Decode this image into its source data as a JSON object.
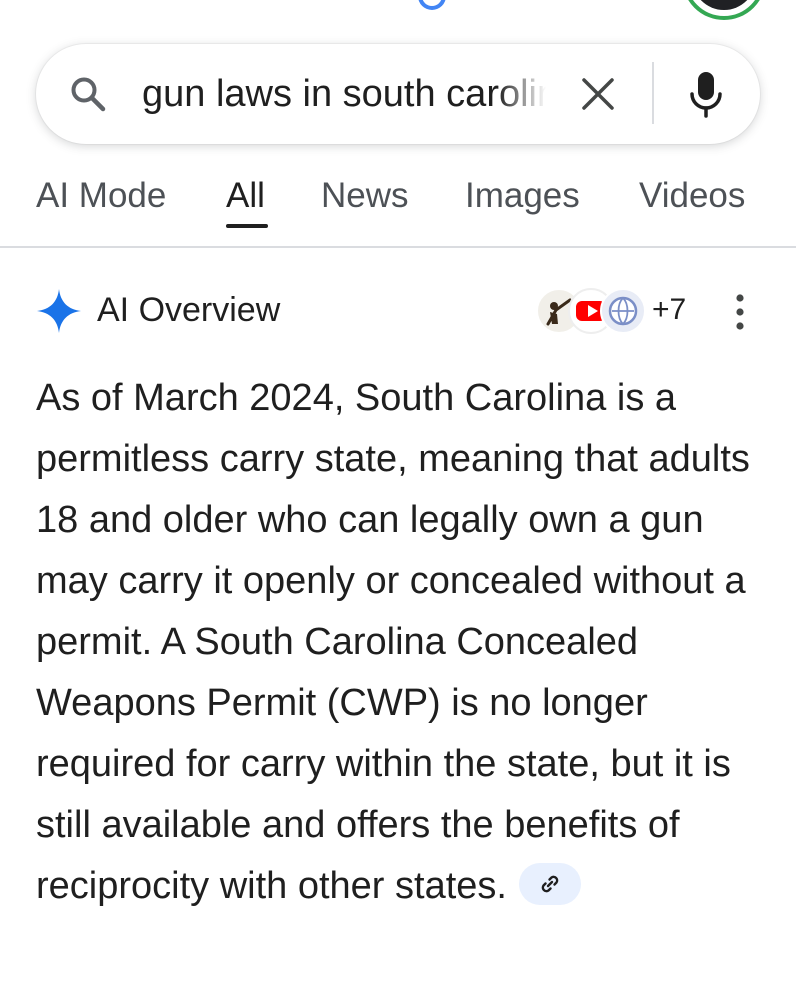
{
  "search": {
    "query": "gun laws in south carolina",
    "icon": "search-icon",
    "clear_icon": "close-icon",
    "voice_icon": "mic-icon"
  },
  "tabs": [
    {
      "label": "AI Mode",
      "active": false
    },
    {
      "label": "All",
      "active": true
    },
    {
      "label": "News",
      "active": false
    },
    {
      "label": "Images",
      "active": false
    },
    {
      "label": "Videos",
      "active": false
    }
  ],
  "ai_overview": {
    "title": "AI Overview",
    "icon": "sparkle-icon",
    "source_count": "+7",
    "menu_icon": "more-vert-icon",
    "body": "As of March 2024, South Carolina is a permitless carry state, meaning that adults 18 and older who can legally own a gun may carry it openly or concealed without a permit. A South Carolina Concealed Weapons Permit (CWP) is no longer required for carry within the state, but it is still available and offers the benefits of reciprocity with other states.",
    "link_icon": "link-icon"
  },
  "colors": {
    "accent_blue": "#4285f4",
    "spark_blue": "#1a73e8",
    "youtube_red": "#ff0000",
    "avatar_ring_green": "#34a853",
    "text": "#1f1f1f",
    "muted": "#4d5156",
    "link_chip_bg": "#e8f0fe"
  }
}
